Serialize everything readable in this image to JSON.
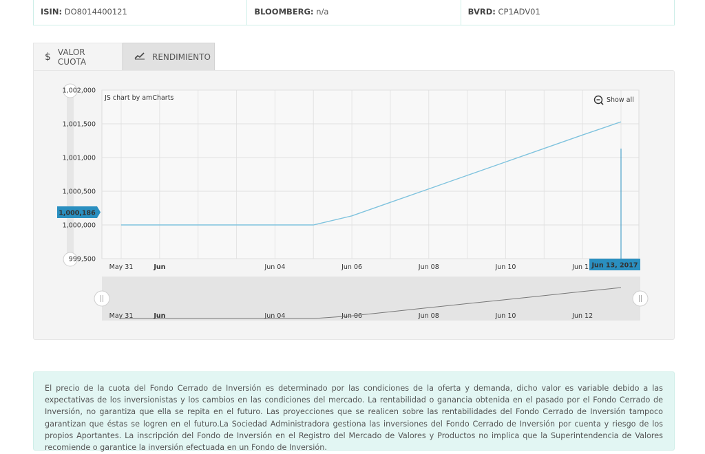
{
  "identifiers": {
    "isin": {
      "label": "ISIN:",
      "value": "DO8014400121"
    },
    "bloomberg": {
      "label": "BLOOMBERG:",
      "value": "n/a"
    },
    "bvrd": {
      "label": "BVRD:",
      "value": "CP1ADV01"
    }
  },
  "tabs": [
    {
      "label": "VALOR CUOTA",
      "icon": "dollar-icon",
      "active": true
    },
    {
      "label": "RENDIMIENTO",
      "icon": "line-chart-icon",
      "active": false
    }
  ],
  "chart_ui": {
    "credit": "JS chart by amCharts",
    "show_all": "Show all",
    "cursor_value": "1,000,186",
    "cursor_date": "Jun 13, 2017",
    "accent": "#2a8fc0",
    "line_color": "#7fc3de"
  },
  "chart_data": {
    "type": "line",
    "title": "",
    "xlabel": "",
    "ylabel": "",
    "x_ticks": [
      "May 31",
      "Jun",
      "Jun 04",
      "Jun 06",
      "Jun 08",
      "Jun 10",
      "Jun 12"
    ],
    "y_ticks": [
      "1,002,000",
      "1,001,500",
      "1,001,000",
      "1,000,500",
      "1,000,000",
      "999,500"
    ],
    "ylim": [
      999500,
      1002000
    ],
    "xlim": [
      "2017-05-31",
      "2017-06-13"
    ],
    "grid": true,
    "series": [
      {
        "x": [
          "2017-05-31",
          "2017-06-01",
          "2017-06-02",
          "2017-06-03",
          "2017-06-04",
          "2017-06-05",
          "2017-06-06",
          "2017-06-07",
          "2017-06-08",
          "2017-06-09",
          "2017-06-10",
          "2017-06-11",
          "2017-06-12",
          "2017-06-13"
        ],
        "y": [
          1000000,
          1000000,
          1000000,
          1000000,
          1000000,
          1000000,
          1000135,
          1000335,
          1000535,
          1000735,
          1000935,
          1001135,
          1001335,
          1001530
        ]
      }
    ]
  },
  "disclaimer": "El precio de la cuota del Fondo Cerrado de Inversión es determinado por las condiciones de la oferta y demanda, dicho valor es variable debido a las expectativas de los inversionistas y los cambios en las condiciones del mercado. La rentabilidad o ganancia obtenida en el pasado por el Fondo Cerrado de Inversión, no garantiza que ella se repita en el futuro. Las proyecciones que se realicen sobre las rentabilidades del Fondo Cerrado de Inversión tampoco garantizan que éstas se logren en el futuro.La Sociedad Administradora gestiona las inversiones del Fondo Cerrado de Inversión por cuenta y riesgo de los propios Aportantes. La inscripción del Fondo de Inversión en el Registro del Mercado de Valores y Productos no implica que la Superintendencia de Valores recomiende o garantice la inversión efectuada en un Fondo de Inversión."
}
